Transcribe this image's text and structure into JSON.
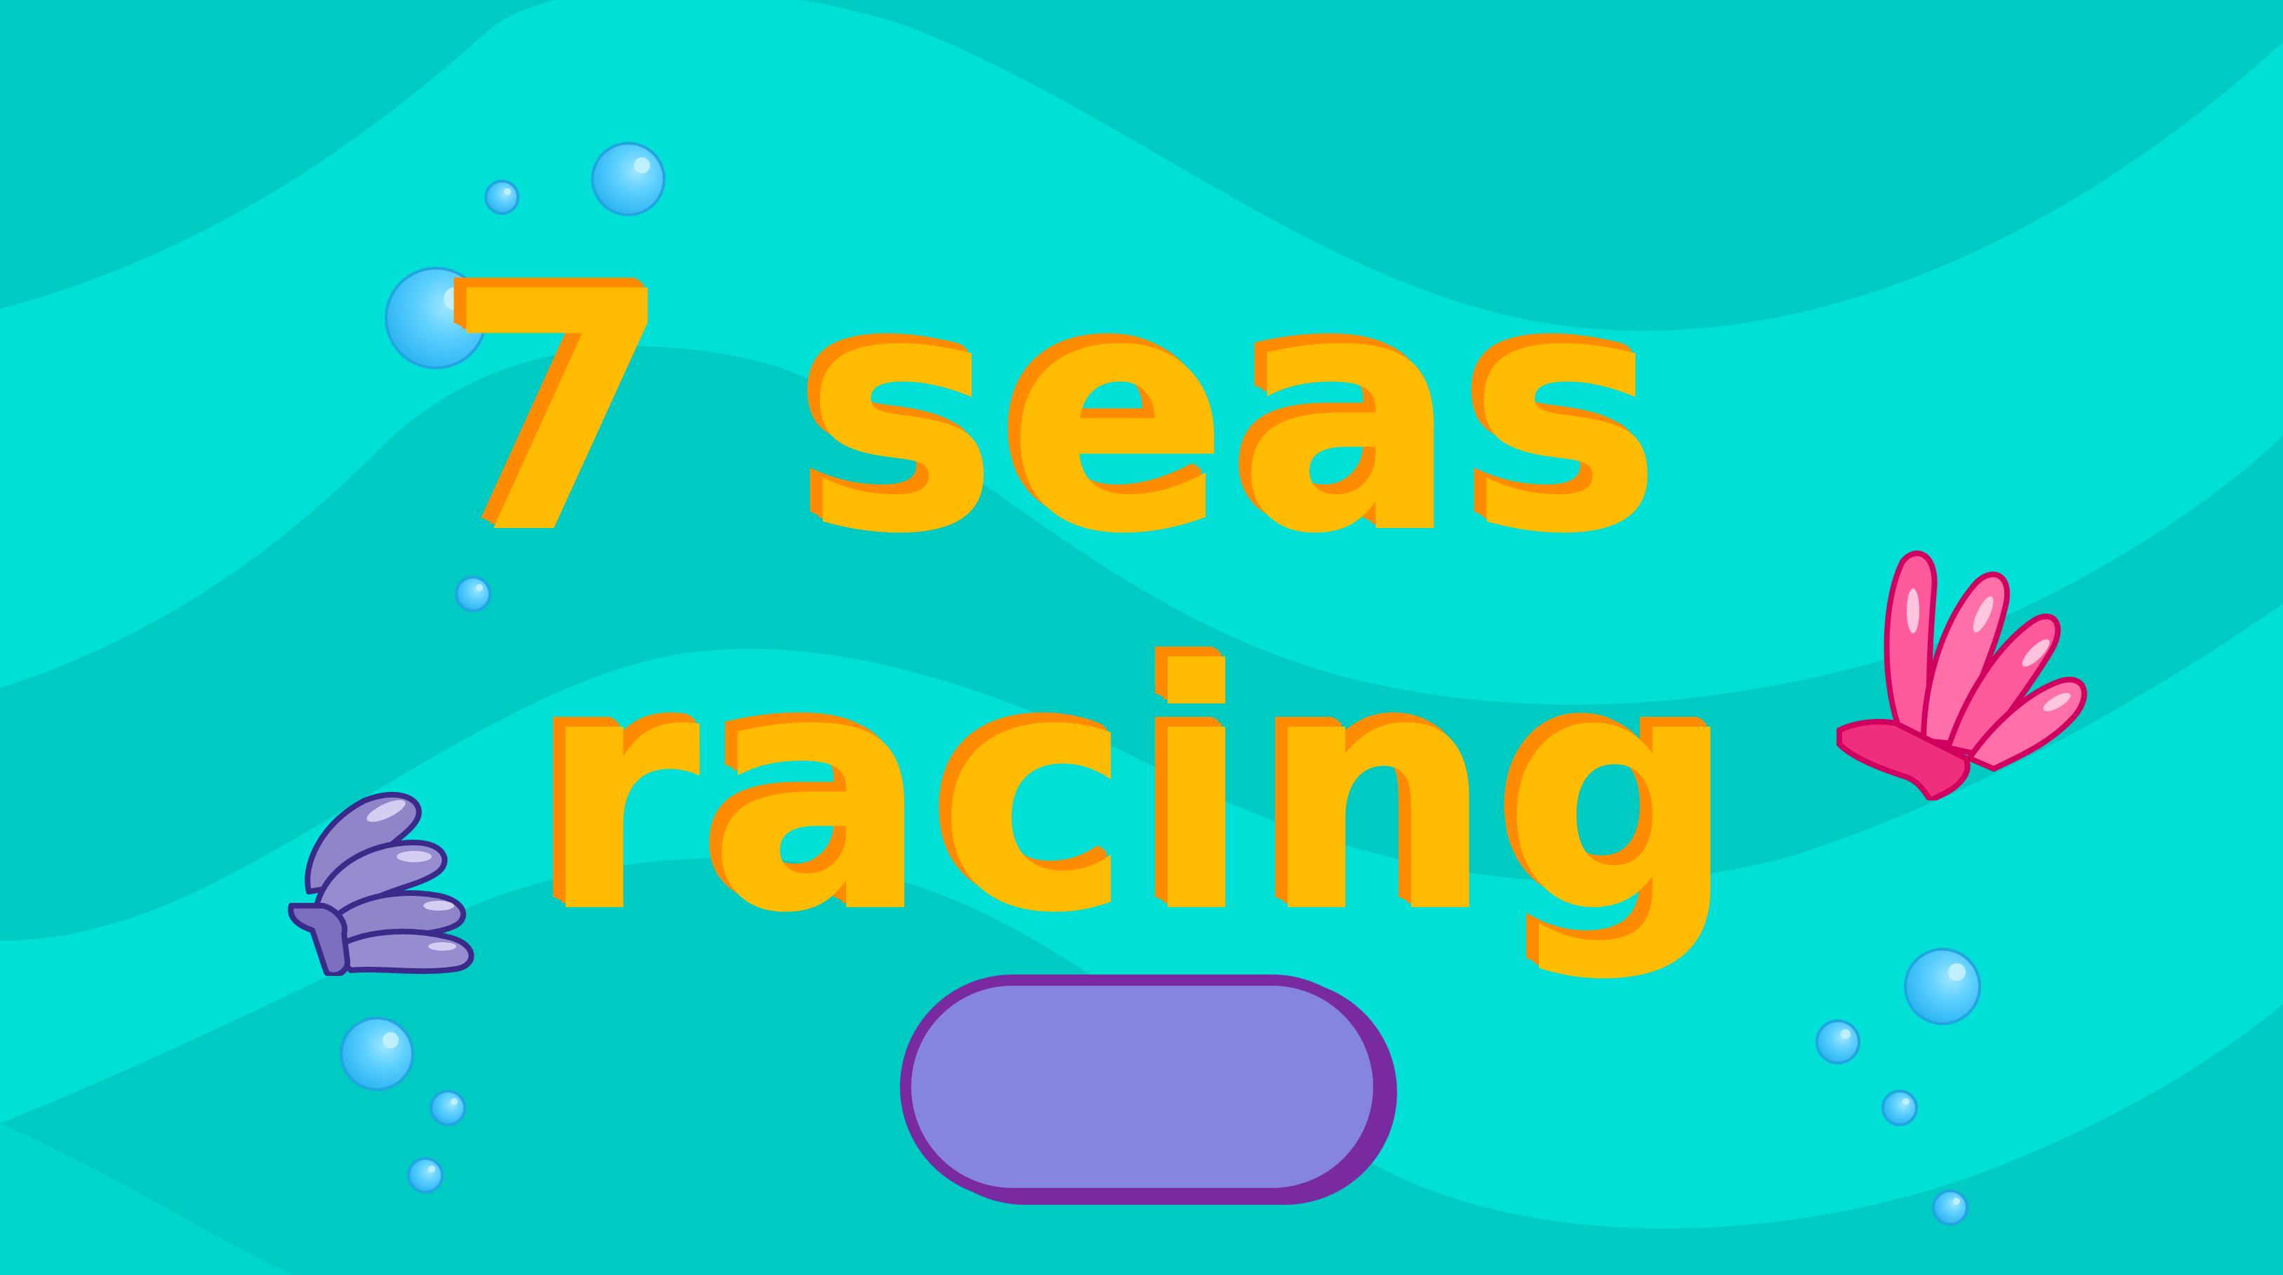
{
  "game": {
    "title_line_1": "7 seas",
    "title_line_2": "racing",
    "play_button_label": ""
  },
  "colors": {
    "background": "#00e0d6",
    "wave_dark": "#00cbc2",
    "title_fill": "#ffbb00",
    "title_shadow": "#ff8c00",
    "button_fill": "#8585dd",
    "button_border": "#7a2aa0",
    "bubble": "#2fb6f2",
    "shell_purple": "#8f86c9",
    "shell_pink": "#ff4d94"
  },
  "icons": {
    "purple_shell": "purple-shell-icon",
    "pink_shell": "pink-shell-icon",
    "bubble": "bubble-icon"
  }
}
